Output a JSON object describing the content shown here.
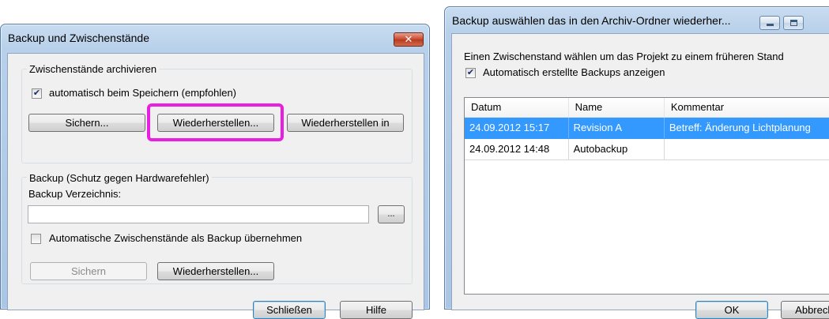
{
  "dialog1": {
    "title": "Backup und Zwischenstände",
    "close_glyph": "✕",
    "group_archive": {
      "label": "Zwischenstände archivieren",
      "auto_save_checked": true,
      "auto_save_label": "automatisch beim Speichern (empfohlen)",
      "btn_save": "Sichern...",
      "btn_restore": "Wiederherstellen...",
      "btn_restore_in": "Wiederherstellen in"
    },
    "group_backup": {
      "label": "Backup (Schutz gegen Hardwarefehler)",
      "dir_label": "Backup Verzeichnis:",
      "dir_value": "",
      "browse_label": "...",
      "auto_backup_checked": false,
      "auto_backup_label": "Automatische Zwischenstände als Backup übernehmen",
      "btn_save": "Sichern",
      "btn_restore": "Wiederherstellen..."
    },
    "btn_close": "Schließen",
    "btn_help": "Hilfe",
    "highlight_color": "#e81fe0"
  },
  "dialog2": {
    "title": "Backup auswählen das in den Archiv-Ordner wiederher...",
    "instruction": "Einen Zwischenstand wählen um das Projekt zu einem früheren Stand",
    "show_auto_checked": true,
    "show_auto_label": "Automatisch erstellte Backups anzeigen",
    "columns": [
      "Datum",
      "Name",
      "Kommentar"
    ],
    "rows": [
      {
        "date": "24.09.2012 15:17",
        "name": "Revision A",
        "comment": "Betreff: Änderung Lichtplanung",
        "selected": true
      },
      {
        "date": "24.09.2012 14:48",
        "name": "Autobackup",
        "comment": "",
        "selected": false
      }
    ],
    "btn_ok": "OK",
    "btn_cancel": "Abbreche",
    "selection_color": "#3399ff"
  }
}
